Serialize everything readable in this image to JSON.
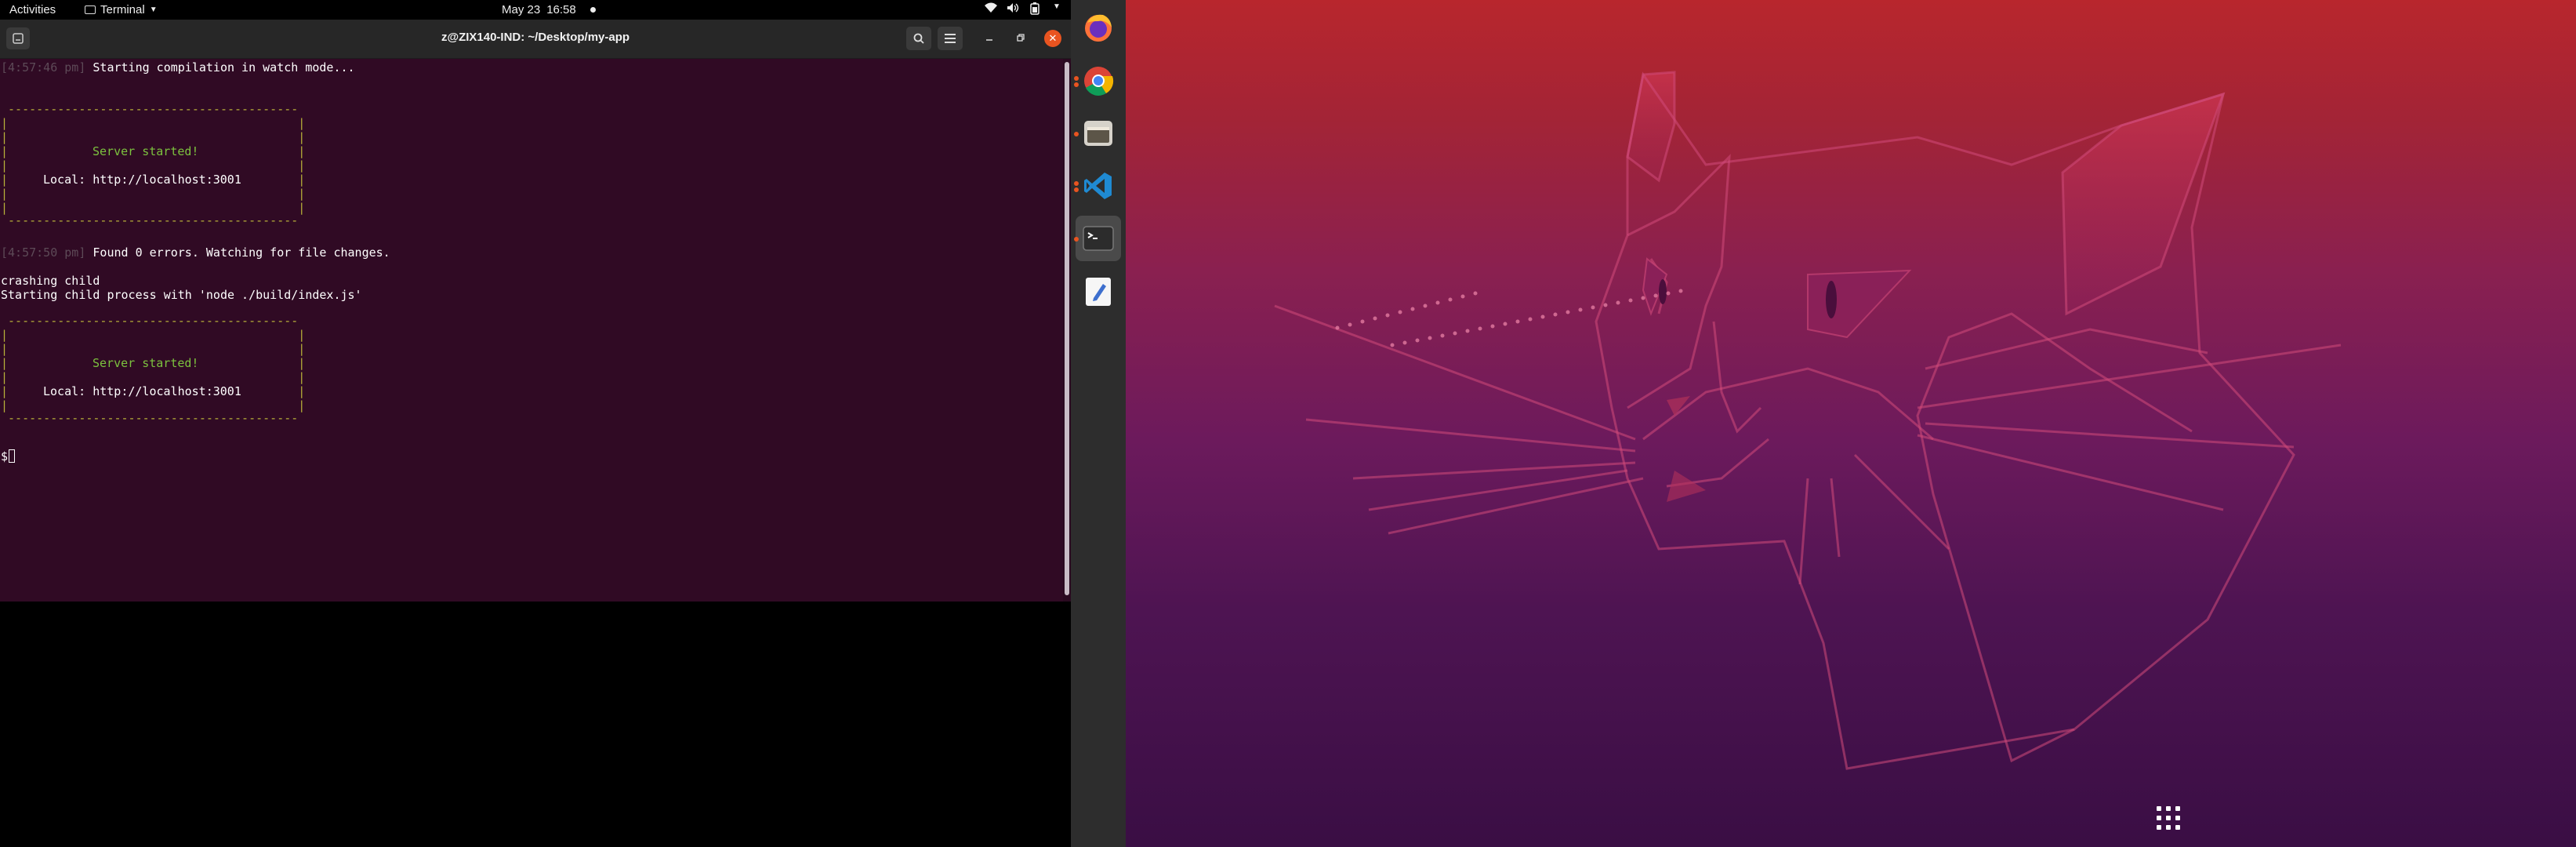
{
  "topbar": {
    "activities": "Activities",
    "app_name": "Terminal",
    "date": "May 23",
    "time": "16:58",
    "tray_icons": [
      "wifi-icon",
      "volume-icon",
      "battery-icon",
      "power-menu-icon"
    ]
  },
  "terminal": {
    "title": "z@ZIX140-IND: ~/Desktop/my-app",
    "header_buttons": [
      "new-tab",
      "search",
      "menu",
      "minimize",
      "maximize",
      "close"
    ],
    "lines": {
      "l1_ts": "[4:57:46 pm]",
      "l1_text": " Starting compilation in watch mode...",
      "box1_top": " -----------------------------------------",
      "box1_server": "Server started!",
      "box1_local": "Local: http://localhost:3001",
      "box1_bottom": " -----------------------------------------",
      "l2_ts": "[4:57:50 pm]",
      "l2_text": " Found 0 errors. Watching for file changes.",
      "l3": "crashing child",
      "l4": "Starting child process with 'node ./build/index.js'",
      "box2_top": " -----------------------------------------",
      "box2_server": "Server started!",
      "box2_local": "Local: http://localhost:3001",
      "box2_bottom": " -----------------------------------------",
      "prompt": "$"
    }
  },
  "dock": {
    "apps": [
      {
        "name": "firefox",
        "running": false
      },
      {
        "name": "chrome",
        "running": true
      },
      {
        "name": "files",
        "running": true
      },
      {
        "name": "vscode",
        "running": true
      },
      {
        "name": "terminal",
        "running": true,
        "active": true
      },
      {
        "name": "text-editor",
        "running": false
      }
    ],
    "show_apps": "show-applications-icon"
  },
  "colors": {
    "terminal_bg": "#300a24",
    "accent": "#e95420",
    "box_yellow": "#b8b13a",
    "server_green": "#7cc23e"
  }
}
